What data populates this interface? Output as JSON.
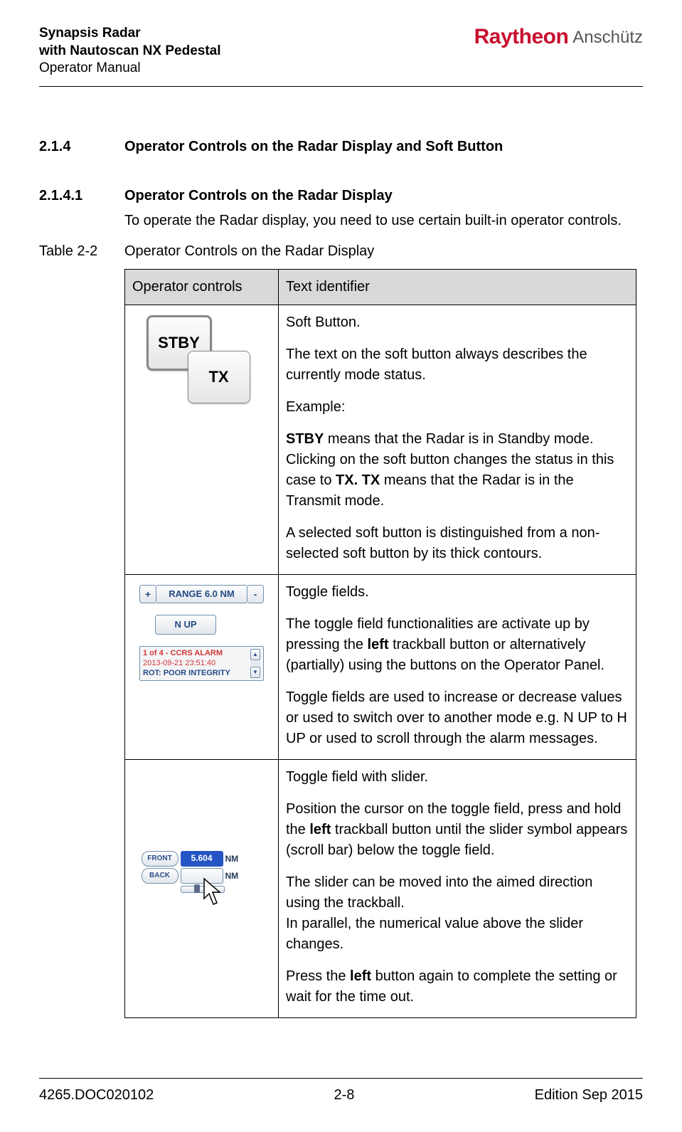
{
  "header": {
    "title_line1": "Synapsis Radar",
    "title_line2": "with Nautoscan NX Pedestal",
    "title_line3": "Operator Manual",
    "logo_brand": "Raytheon",
    "logo_sub": "Anschütz"
  },
  "sections": {
    "s214": {
      "num": "2.1.4",
      "title": "Operator Controls on the Radar Display and Soft Button"
    },
    "s2141": {
      "num": "2.1.4.1",
      "title": "Operator Controls on the Radar Display",
      "intro": "To operate the Radar display, you need to use certain built-in operator controls."
    }
  },
  "table_caption": {
    "label": "Table 2-2",
    "text": "Operator Controls on the Radar Display"
  },
  "table": {
    "head": {
      "c1": "Operator controls",
      "c2": "Text identifier"
    },
    "row1": {
      "btn_stby": "STBY",
      "btn_tx": "TX",
      "p1": "Soft Button.",
      "p2": "The text on the soft button always describes the currently mode status.",
      "p3": "Example:",
      "p4a": "STBY",
      "p4b": " means that the Radar is in Standby mode. Clicking on the soft button changes the status in this case to ",
      "p4c": "TX. TX",
      "p4d": " means that the Radar is in the Transmit mode.",
      "p5": "A selected soft button is distinguished from a non-selected soft button by its thick contours."
    },
    "row2": {
      "range_plus": "+",
      "range_text": "RANGE 6.0 NM",
      "range_minus": "-",
      "nup": "N UP",
      "alarm_l1": "1 of 4 - CCRS ALARM",
      "alarm_l2": "2013-09-21 23:51:40",
      "alarm_l3": "ROT: POOR INTEGRITY",
      "p1": "Toggle fields.",
      "p2a": "The toggle field functionalities are activate up by pressing the ",
      "p2b": "left",
      "p2c": " trackball button or alternatively (partially) using the buttons on the Operator Panel.",
      "p3": "Toggle fields are used to increase or decrease values or used to switch over to another mode e.g. N UP to H UP or used to scroll through the alarm messages."
    },
    "row3": {
      "front": "FRONT",
      "back": "BACK",
      "val1": "5.604",
      "val2": "",
      "nm": "NM",
      "p1": "Toggle field with slider.",
      "p2a": "Position the cursor on the toggle field, press and hold the ",
      "p2b": "left",
      "p2c": " trackball button until the slider symbol appears (scroll bar) below the toggle field.",
      "p3": "The slider can be moved into the aimed direction using the trackball.",
      "p4": "In parallel, the numerical value above the slider changes.",
      "p5a": "Press the ",
      "p5b": "left",
      "p5c": " button again to complete the setting or wait for the time out."
    }
  },
  "footer": {
    "doc": "4265.DOC020102",
    "page": "2-8",
    "edition": "Edition Sep 2015"
  }
}
